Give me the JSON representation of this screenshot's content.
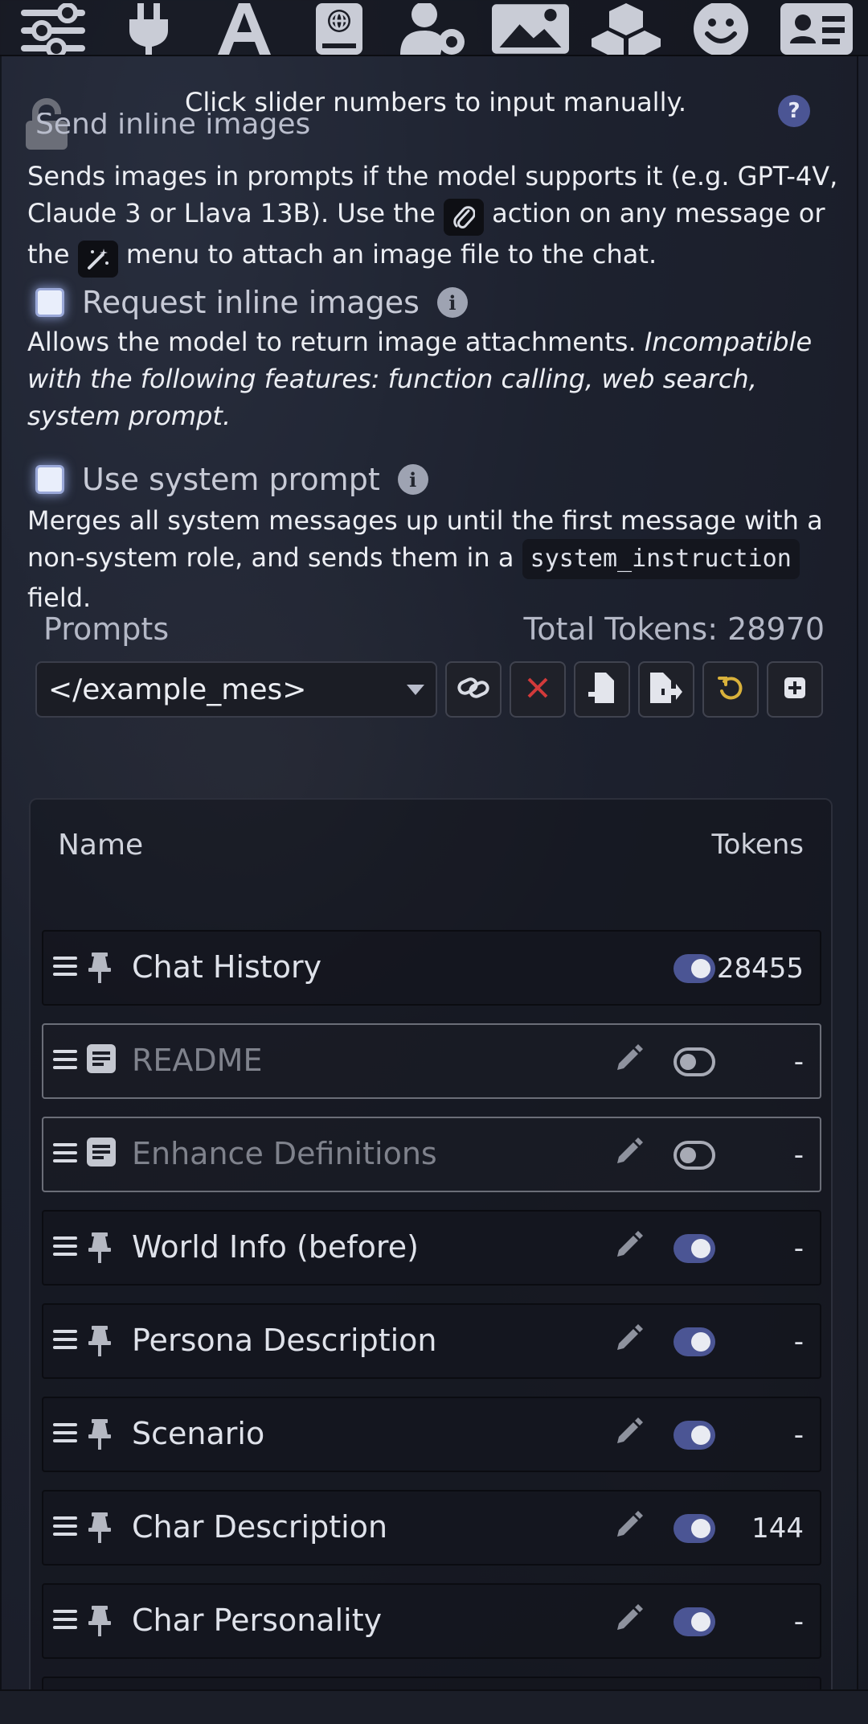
{
  "topbar": {
    "icons": [
      "sliders-icon",
      "plug-icon",
      "font-icon",
      "book-globe-icon",
      "user-gear-icon",
      "image-icon",
      "cubes-icon",
      "smiley-icon",
      "contact-card-icon"
    ]
  },
  "hint": "Click slider numbers to input manually.",
  "help_badge": "?",
  "send_inline": {
    "label": "Send inline images",
    "desc_part1": "Sends images in prompts if the model supports it (e.g. GPT-4V, Claude 3 or Llava 13B). Use the ",
    "desc_part2": " action on any message or the ",
    "desc_part3": " menu to attach an image file to the chat."
  },
  "request_inline": {
    "label": "Request inline images",
    "desc": "Allows the model to return image attachments. ",
    "desc_em": "Incompatible with the following features: function calling, web search, system prompt."
  },
  "system_prompt": {
    "label": "Use system prompt",
    "desc_part1": "Merges all system messages up until the first message with a non-system role, and sends them in a ",
    "code": "system_instruction",
    "desc_part2": " field."
  },
  "prompts": {
    "title": "Prompts",
    "total_tokens": "Total Tokens: 28970",
    "selected": "</example_mes>",
    "buttons": [
      "link-icon",
      "delete-icon",
      "import-icon",
      "export-icon",
      "reset-icon",
      "add-icon"
    ]
  },
  "table": {
    "col_name": "Name",
    "col_tokens": "Tokens",
    "rows": [
      {
        "name": "Chat History",
        "kind": "pin-icon",
        "enabled": true,
        "tokens": "28455",
        "editable": false,
        "disabled_style": false
      },
      {
        "name": "README",
        "kind": "note-icon",
        "enabled": false,
        "tokens": "-",
        "editable": true,
        "disabled_style": true
      },
      {
        "name": "Enhance Definitions",
        "kind": "note-icon",
        "enabled": false,
        "tokens": "-",
        "editable": true,
        "disabled_style": true
      },
      {
        "name": "World Info (before)",
        "kind": "pin-icon",
        "enabled": true,
        "tokens": "-",
        "editable": true,
        "disabled_style": false
      },
      {
        "name": "Persona Description",
        "kind": "pin-icon",
        "enabled": true,
        "tokens": "-",
        "editable": true,
        "disabled_style": false
      },
      {
        "name": "Scenario",
        "kind": "pin-icon",
        "enabled": true,
        "tokens": "-",
        "editable": true,
        "disabled_style": false
      },
      {
        "name": "Char Description",
        "kind": "pin-icon",
        "enabled": true,
        "tokens": "144",
        "editable": true,
        "disabled_style": false
      },
      {
        "name": "Char Personality",
        "kind": "pin-icon",
        "enabled": true,
        "tokens": "-",
        "editable": true,
        "disabled_style": false
      }
    ]
  },
  "colors": {
    "accent": "#4b5594",
    "background": "#1d2130"
  }
}
